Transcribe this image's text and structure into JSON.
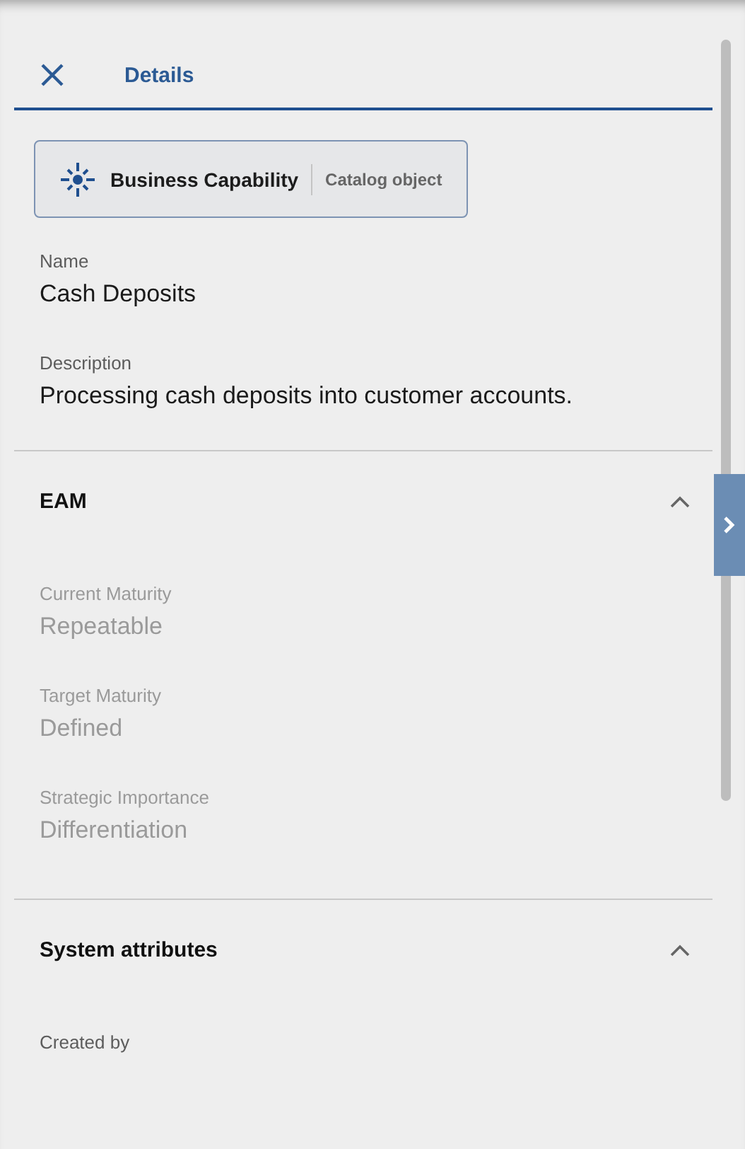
{
  "header": {
    "title": "Details"
  },
  "object_badge": {
    "type": "Business Capability",
    "category": "Catalog object"
  },
  "fields": [
    {
      "label": "Name",
      "value": "Cash Deposits",
      "disabled": false
    },
    {
      "label": "Description",
      "value": "Processing cash deposits into customer accounts.",
      "disabled": false
    }
  ],
  "sections": [
    {
      "title": "EAM",
      "expanded": true,
      "fields": [
        {
          "label": "Current Maturity",
          "value": "Repeatable",
          "disabled": true
        },
        {
          "label": "Target Maturity",
          "value": "Defined",
          "disabled": true
        },
        {
          "label": "Strategic Importance",
          "value": "Differentiation",
          "disabled": true
        }
      ]
    },
    {
      "title": "System attributes",
      "expanded": true,
      "fields": [
        {
          "label": "Created by",
          "disabled": false
        }
      ]
    }
  ]
}
